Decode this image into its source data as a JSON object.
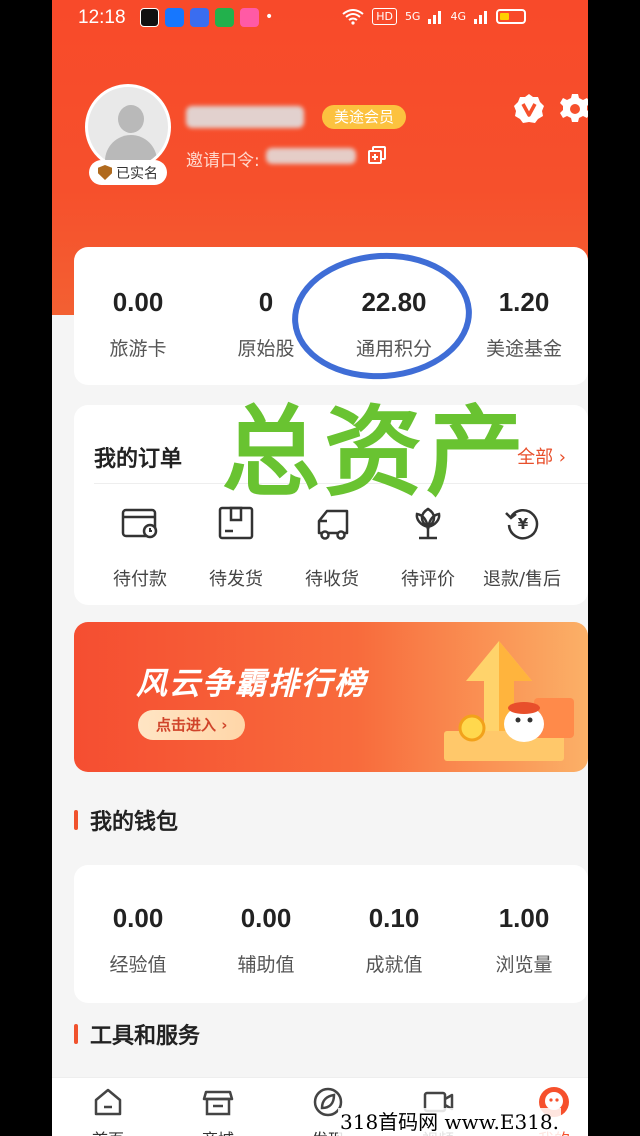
{
  "status": {
    "time": "12:18",
    "hd": "HD",
    "net1": "5G",
    "net2": "4G"
  },
  "profile": {
    "verified": "已实名",
    "member": "美途会员",
    "invite_label": "邀请口令: "
  },
  "assets": [
    {
      "value": "0.00",
      "label": "旅游卡"
    },
    {
      "value": "0",
      "label": "原始股"
    },
    {
      "value": "22.80",
      "label": "通用积分"
    },
    {
      "value": "1.20",
      "label": "美途基金"
    }
  ],
  "overlay": "总资产",
  "orders": {
    "title": "我的订单",
    "all": "全部 ›",
    "items": [
      {
        "label": "待付款",
        "icon": "wallet-icon"
      },
      {
        "label": "待发货",
        "icon": "package-icon"
      },
      {
        "label": "待收货",
        "icon": "truck-icon"
      },
      {
        "label": "待评价",
        "icon": "flower-icon"
      },
      {
        "label": "退款/售后",
        "icon": "refund-icon"
      }
    ]
  },
  "banner": {
    "title": "风云争霸排行榜",
    "button": "点击进入 ›"
  },
  "wallet": {
    "title": "我的钱包",
    "items": [
      {
        "value": "0.00",
        "label": "经验值"
      },
      {
        "value": "0.00",
        "label": "辅助值"
      },
      {
        "value": "0.10",
        "label": "成就值"
      },
      {
        "value": "1.00",
        "label": "浏览量"
      }
    ]
  },
  "tools": {
    "title": "工具和服务"
  },
  "tabs": [
    {
      "label": "首页",
      "icon": "home-icon"
    },
    {
      "label": "商城",
      "icon": "store-icon"
    },
    {
      "label": "发现",
      "icon": "leaf-icon"
    },
    {
      "label": "视频",
      "icon": "video-icon"
    },
    {
      "label": "我的",
      "icon": "profile-icon"
    }
  ],
  "watermark": "318首码网 www.E318.",
  "colors": {
    "brand": "#f6502c",
    "accent_gold": "#fcc23f",
    "circle_blue": "#3f6dd6",
    "overlay_green": "#69c331"
  }
}
